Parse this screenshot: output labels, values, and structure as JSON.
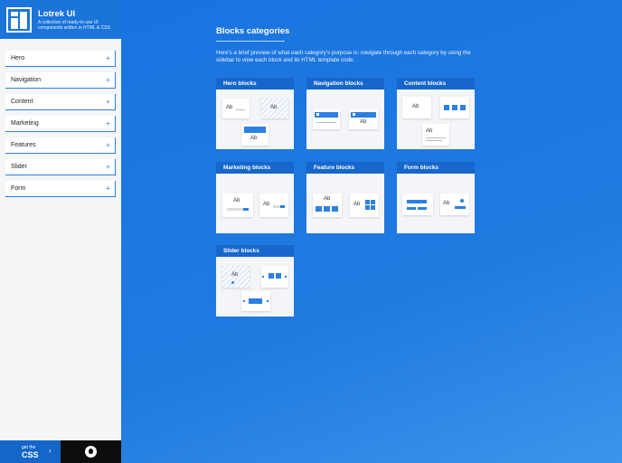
{
  "brand": {
    "title": "Lotrek UI",
    "subtitle": "A collection of ready-to-use UI components written in HTML & CSS"
  },
  "sidebar": {
    "items": [
      {
        "label": "Hero"
      },
      {
        "label": "Navigation"
      },
      {
        "label": "Content"
      },
      {
        "label": "Marketing"
      },
      {
        "label": "Features"
      },
      {
        "label": "Slider"
      },
      {
        "label": "Form"
      }
    ],
    "expand_glyph": "+"
  },
  "footer": {
    "css_small": "get the",
    "css_big": "CSS",
    "chevron": "›",
    "github_icon": "github-icon"
  },
  "main": {
    "title": "Blocks categories",
    "description": "Here's a brief preview of what each category's purpose is: navigate through each category by using the sidebar to view each block and its HTML template code.",
    "cards": [
      {
        "label": "Hero blocks"
      },
      {
        "label": "Navigation blocks"
      },
      {
        "label": "Content blocks"
      },
      {
        "label": "Marketing blocks"
      },
      {
        "label": "Feature blocks"
      },
      {
        "label": "Form blocks"
      },
      {
        "label": "Slider blocks"
      }
    ],
    "preview_text": "Ab"
  },
  "colors": {
    "accent": "#1f7ae0",
    "card_header": "#1766cc",
    "sidebar_bg": "#f4f5f7",
    "github_bg": "#0d0d0d"
  }
}
